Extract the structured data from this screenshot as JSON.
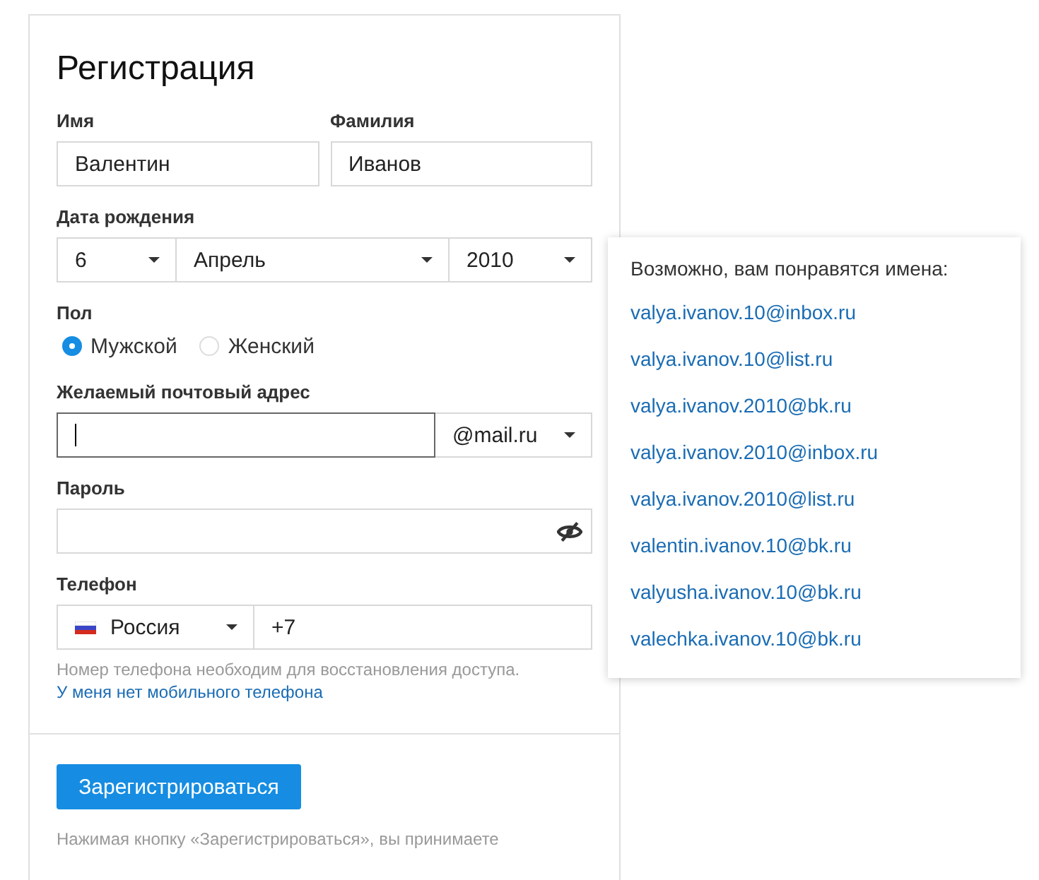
{
  "title": "Регистрация",
  "first_name": {
    "label": "Имя",
    "value": "Валентин"
  },
  "last_name": {
    "label": "Фамилия",
    "value": "Иванов"
  },
  "birth_date": {
    "label": "Дата рождения",
    "day": "6",
    "month": "Апрель",
    "year": "2010"
  },
  "gender": {
    "label": "Пол",
    "options": [
      {
        "label": "Мужской",
        "selected": true
      },
      {
        "label": "Женский",
        "selected": false
      }
    ]
  },
  "email": {
    "label": "Желаемый почтовый адрес",
    "focused": true,
    "domain": "@mail.ru"
  },
  "password": {
    "label": "Пароль"
  },
  "phone": {
    "label": "Телефон",
    "country": "Россия",
    "value": "+7",
    "hint": "Номер телефона необходим для восстановления доступа.",
    "no_phone_link": "У меня нет мобильного телефона"
  },
  "submit": "Зарегистрироваться",
  "footer": "Нажимая кнопку «Зарегистрироваться», вы принимаете",
  "suggestions": {
    "title": "Возможно, вам понравятся имена:",
    "items": [
      "valya.ivanov.10@inbox.ru",
      "valya.ivanov.10@list.ru",
      "valya.ivanov.2010@bk.ru",
      "valya.ivanov.2010@inbox.ru",
      "valya.ivanov.2010@list.ru",
      "valentin.ivanov.10@bk.ru",
      "valyusha.ivanov.10@bk.ru",
      "valechka.ivanov.10@bk.ru"
    ]
  }
}
